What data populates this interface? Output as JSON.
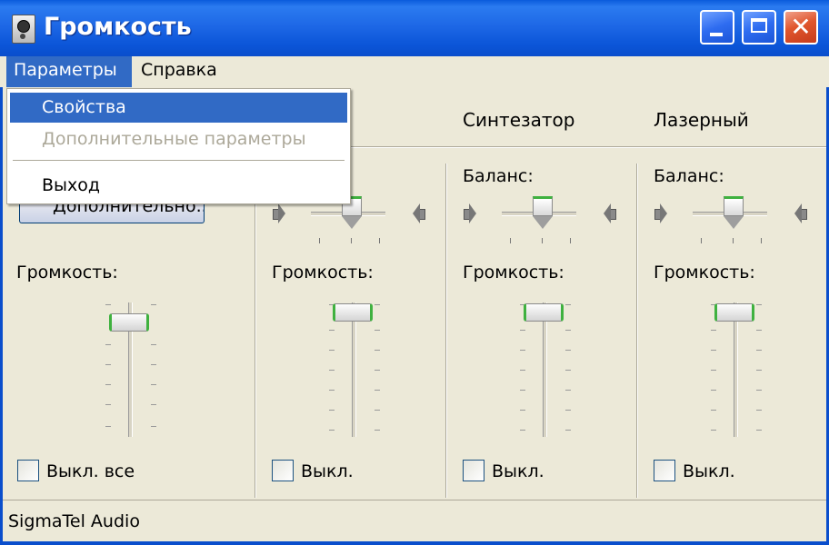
{
  "window": {
    "title": "Громкость",
    "icon": "speaker-icon",
    "controls": {
      "minimize": "minimize-icon",
      "maximize": "maximize-icon",
      "close": "close-icon"
    }
  },
  "menubar": {
    "items": [
      {
        "label": "Параметры"
      },
      {
        "label": "Справка"
      }
    ]
  },
  "dropdown": {
    "items": [
      {
        "label": "Свойства",
        "state": "highlighted"
      },
      {
        "label": "Дополнительные параметры",
        "state": "disabled"
      },
      {
        "label": "Выход",
        "state": "normal"
      }
    ]
  },
  "master": {
    "advanced_button": "Дополнительно...",
    "volume_label": "Громкость:",
    "mute_label": "Выкл. все",
    "muted": false
  },
  "channels": [
    {
      "name": "",
      "balance_label": "",
      "volume_label": "Громкость:",
      "mute_label": "Выкл.",
      "muted": false
    },
    {
      "name": "Синтезатор",
      "balance_label": "Баланс:",
      "volume_label": "Громкость:",
      "mute_label": "Выкл.",
      "muted": false
    },
    {
      "name": "Лазерный",
      "balance_label": "Баланс:",
      "volume_label": "Громкость:",
      "mute_label": "Выкл.",
      "muted": false
    }
  ],
  "statusbar": {
    "text": "SigmaTel Audio"
  },
  "colors": {
    "titlebar": "#0A5BDC",
    "highlight": "#316AC5",
    "window_bg": "#ECE9D8",
    "thumb_accent": "#3FB13F"
  }
}
